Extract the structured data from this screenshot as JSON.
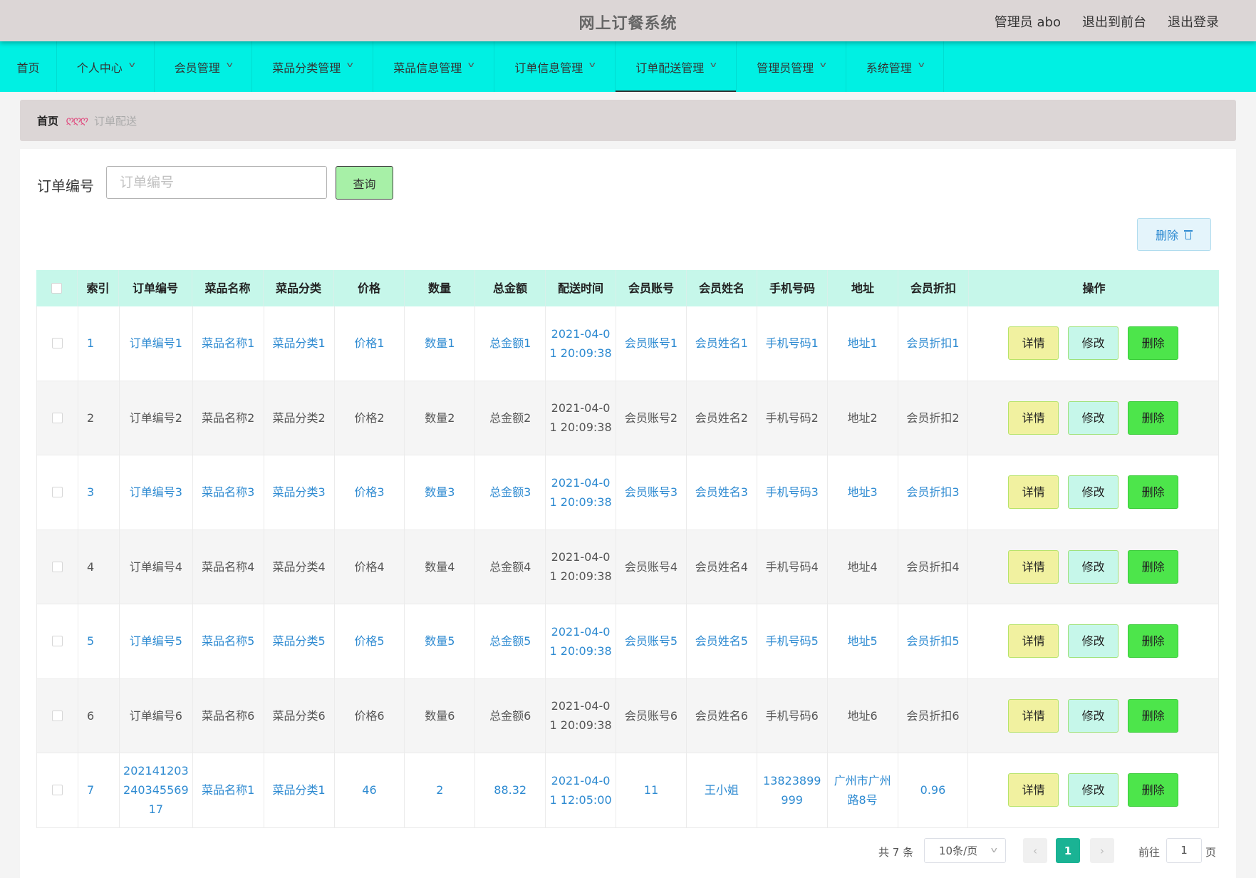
{
  "header": {
    "title": "网上订餐系统",
    "admin_label": "管理员 abo",
    "to_front": "退出到前台",
    "logout": "退出登录"
  },
  "nav": {
    "items": [
      {
        "label": "首页",
        "has_dropdown": false
      },
      {
        "label": "个人中心",
        "has_dropdown": true
      },
      {
        "label": "会员管理",
        "has_dropdown": true
      },
      {
        "label": "菜品分类管理",
        "has_dropdown": true
      },
      {
        "label": "菜品信息管理",
        "has_dropdown": true
      },
      {
        "label": "订单信息管理",
        "has_dropdown": true
      },
      {
        "label": "订单配送管理",
        "has_dropdown": true,
        "active": true
      },
      {
        "label": "管理员管理",
        "has_dropdown": true
      },
      {
        "label": "系统管理",
        "has_dropdown": true
      }
    ]
  },
  "breadcrumb": {
    "home": "首页",
    "separator": "ღღღ",
    "current": "订单配送"
  },
  "search": {
    "label": "订单编号",
    "placeholder": "订单编号",
    "button": "查询"
  },
  "batch_delete_label": "删除",
  "table": {
    "headers": [
      "索引",
      "订单编号",
      "菜品名称",
      "菜品分类",
      "价格",
      "数量",
      "总金额",
      "配送时间",
      "会员账号",
      "会员姓名",
      "手机号码",
      "地址",
      "会员折扣",
      "操作"
    ],
    "rows": [
      {
        "index": "1",
        "order_no": "订单编号1",
        "dish": "菜品名称1",
        "category": "菜品分类1",
        "price": "价格1",
        "qty": "数量1",
        "total": "总金额1",
        "time": "2021-04-01 20:09:38",
        "account": "会员账号1",
        "name": "会员姓名1",
        "phone": "手机号码1",
        "address": "地址1",
        "discount": "会员折扣1",
        "style": "link"
      },
      {
        "index": "2",
        "order_no": "订单编号2",
        "dish": "菜品名称2",
        "category": "菜品分类2",
        "price": "价格2",
        "qty": "数量2",
        "total": "总金额2",
        "time": "2021-04-01 20:09:38",
        "account": "会员账号2",
        "name": "会员姓名2",
        "phone": "手机号码2",
        "address": "地址2",
        "discount": "会员折扣2",
        "style": "plain"
      },
      {
        "index": "3",
        "order_no": "订单编号3",
        "dish": "菜品名称3",
        "category": "菜品分类3",
        "price": "价格3",
        "qty": "数量3",
        "total": "总金额3",
        "time": "2021-04-01 20:09:38",
        "account": "会员账号3",
        "name": "会员姓名3",
        "phone": "手机号码3",
        "address": "地址3",
        "discount": "会员折扣3",
        "style": "link"
      },
      {
        "index": "4",
        "order_no": "订单编号4",
        "dish": "菜品名称4",
        "category": "菜品分类4",
        "price": "价格4",
        "qty": "数量4",
        "total": "总金额4",
        "time": "2021-04-01 20:09:38",
        "account": "会员账号4",
        "name": "会员姓名4",
        "phone": "手机号码4",
        "address": "地址4",
        "discount": "会员折扣4",
        "style": "plain"
      },
      {
        "index": "5",
        "order_no": "订单编号5",
        "dish": "菜品名称5",
        "category": "菜品分类5",
        "price": "价格5",
        "qty": "数量5",
        "total": "总金额5",
        "time": "2021-04-01 20:09:38",
        "account": "会员账号5",
        "name": "会员姓名5",
        "phone": "手机号码5",
        "address": "地址5",
        "discount": "会员折扣5",
        "style": "link"
      },
      {
        "index": "6",
        "order_no": "订单编号6",
        "dish": "菜品名称6",
        "category": "菜品分类6",
        "price": "价格6",
        "qty": "数量6",
        "total": "总金额6",
        "time": "2021-04-01 20:09:38",
        "account": "会员账号6",
        "name": "会员姓名6",
        "phone": "手机号码6",
        "address": "地址6",
        "discount": "会员折扣6",
        "style": "plain"
      },
      {
        "index": "7",
        "order_no": "202141203240345569 17",
        "dish": "菜品名称1",
        "category": "菜品分类1",
        "price": "46",
        "qty": "2",
        "total": "88.32",
        "time": "2021-04-01 12:05:00",
        "account": "11",
        "name": "王小姐",
        "phone": "13823899999",
        "address": "广州市广州路8号",
        "discount": "0.96",
        "style": "link"
      }
    ],
    "actions": {
      "detail": "详情",
      "edit": "修改",
      "delete": "删除"
    }
  },
  "pagination": {
    "total_text": "共 7 条",
    "page_size": "10条/页",
    "prev_icon": "‹",
    "current_page": "1",
    "next_icon": "›",
    "goto_label": "前往",
    "goto_value": "1",
    "page_unit": "页"
  },
  "colors": {
    "nav_bg": "#00f0e3",
    "header_bg": "#dcd6d6",
    "table_head_bg": "#c6f7ea",
    "link": "#2d8ad1",
    "detail_btn": "#f1f1a0",
    "edit_btn": "#c6f7ea",
    "delete_btn": "#4de54b",
    "page_active": "#1ab394"
  }
}
